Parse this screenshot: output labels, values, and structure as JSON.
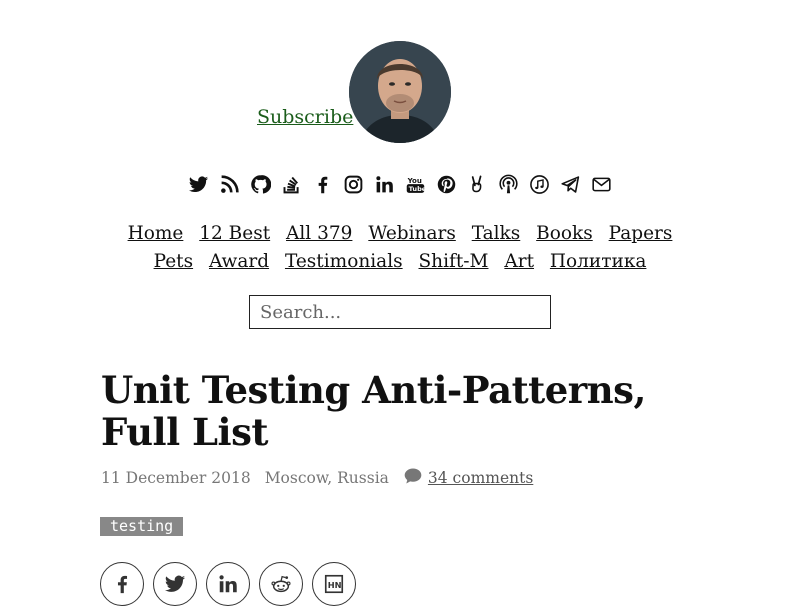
{
  "header": {
    "subscribe_label": "Subscribe"
  },
  "social_icons": [
    "twitter-icon",
    "rss-icon",
    "github-icon",
    "stackoverflow-icon",
    "facebook-icon",
    "instagram-icon",
    "linkedin-icon",
    "youtube-icon",
    "pinterest-icon",
    "peace-icon",
    "podcast-icon",
    "music-icon",
    "telegram-icon",
    "email-icon"
  ],
  "nav": {
    "items": [
      "Home",
      "12 Best",
      "All 379",
      "Webinars",
      "Talks",
      "Books",
      "Papers",
      "Pets",
      "Award",
      "Testimonials",
      "Shift-M",
      "Art",
      "Политика"
    ]
  },
  "search": {
    "placeholder": "Search..."
  },
  "article": {
    "title": "Unit Testing Anti-Patterns, Full List",
    "date": "11 December 2018",
    "location": "Moscow, Russia",
    "comments": "34 comments",
    "tag": "testing"
  },
  "share_buttons": [
    "facebook-icon",
    "twitter-icon",
    "linkedin-icon",
    "reddit-icon",
    "hackernews-icon"
  ],
  "colors": {
    "link_green": "#1a5c1a",
    "tag_bg": "#888888",
    "meta_gray": "#777777"
  }
}
